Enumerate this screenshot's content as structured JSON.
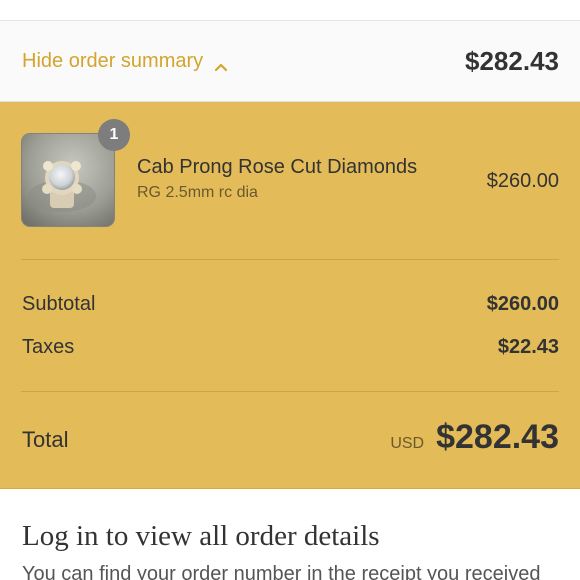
{
  "summary_toggle": {
    "label": "Hide order summary",
    "icon": "chevron-up-icon",
    "total": "$282.43"
  },
  "colors": {
    "accent": "#d3a52e",
    "summary_background": "#e3bb58",
    "badge": "#7d7d7d",
    "text": "#333333"
  },
  "line_items": [
    {
      "quantity": "1",
      "name": "Cab Prong Rose Cut Diamonds",
      "variant": "RG 2.5mm rc dia",
      "price": "$260.00"
    }
  ],
  "totals": {
    "subtotal_label": "Subtotal",
    "subtotal_value": "$260.00",
    "taxes_label": "Taxes",
    "taxes_value": "$22.43",
    "total_label": "Total",
    "currency": "USD",
    "total_value": "$282.43"
  },
  "login": {
    "heading": "Log in to view all order details",
    "text": "You can find your order number in the receipt you received"
  }
}
